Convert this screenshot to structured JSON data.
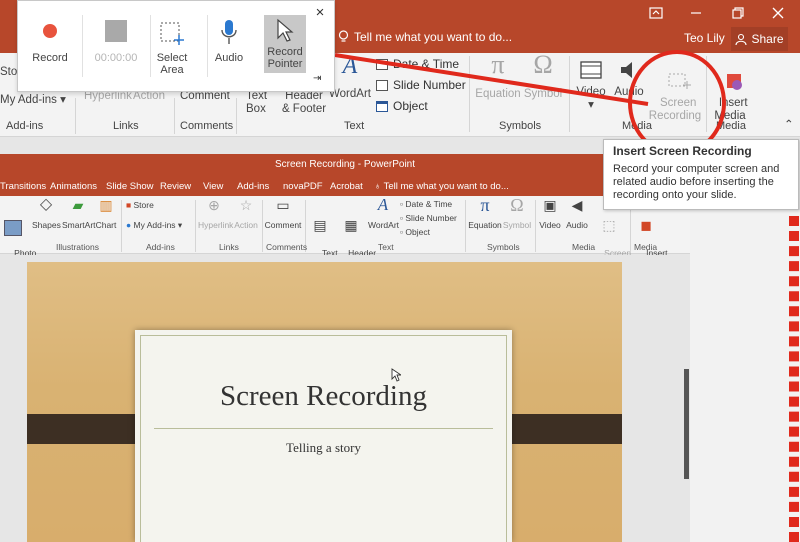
{
  "outer": {
    "tell_me": "Tell me what you want to do...",
    "user": "Teo Lily",
    "share": "Share",
    "ribbon": {
      "store_partial": "Sto",
      "my_addins": "My Add-ins",
      "hyperlink": "Hyperlink",
      "action": "Action",
      "comment": "Comment",
      "text_box": "Text\nBox",
      "header_footer": "Header\n& Footer",
      "wordart": "WordArt",
      "date_time": "Date & Time",
      "slide_number": "Slide Number",
      "object": "Object",
      "equation": "Equation",
      "symbol": "Symbol",
      "video": "Video",
      "audio": "Audio",
      "screen_recording": "Screen\nRecording",
      "insert_media": "Insert\nMedia"
    },
    "groups": [
      "Add-ins",
      "Links",
      "Comments",
      "Text",
      "Symbols",
      "Media",
      "Media"
    ]
  },
  "recorder": {
    "record": "Record",
    "timer": "00:00:00",
    "select_area": "Select\nArea",
    "audio": "Audio",
    "record_pointer": "Record\nPointer",
    "close": "×",
    "pin": "⇥"
  },
  "tooltip": {
    "title": "Insert Screen Recording",
    "body": "Record your computer screen and related audio before inserting the recording onto your slide."
  },
  "inner": {
    "title": "Screen Recording - PowerPoint",
    "tabs": [
      "Transitions",
      "Animations",
      "Slide Show",
      "Review",
      "View",
      "Add-ins",
      "novaPDF",
      "Acrobat"
    ],
    "tell_me": "Tell me what you want to do...",
    "ribbon": {
      "photo_album": "Photo\nAlbum",
      "shapes": "Shapes",
      "smartart": "SmartArt",
      "chart": "Chart",
      "store": "Store",
      "my_addins": "My Add-ins",
      "hyperlink": "Hyperlink",
      "action": "Action",
      "comment": "Comment",
      "text_box": "Text\nBox",
      "header_footer": "Header\n& Footer",
      "wordart": "WordArt",
      "date_time": "Date & Time",
      "slide_number": "Slide Number",
      "object": "Object",
      "equation": "Equation",
      "symbol": "Symbol",
      "video": "Video",
      "audio": "Audio",
      "screen_recording": "Screen\nRecording",
      "insert_media": "Insert\nMedia"
    },
    "groups": [
      "Illustrations",
      "Add-ins",
      "Links",
      "Comments",
      "Text",
      "Symbols",
      "Media",
      "Media"
    ]
  },
  "slide": {
    "title": "Screen Recording",
    "subtitle": "Telling a story"
  },
  "colors": {
    "accent": "#b7472a",
    "highlight": "#e0291c"
  }
}
